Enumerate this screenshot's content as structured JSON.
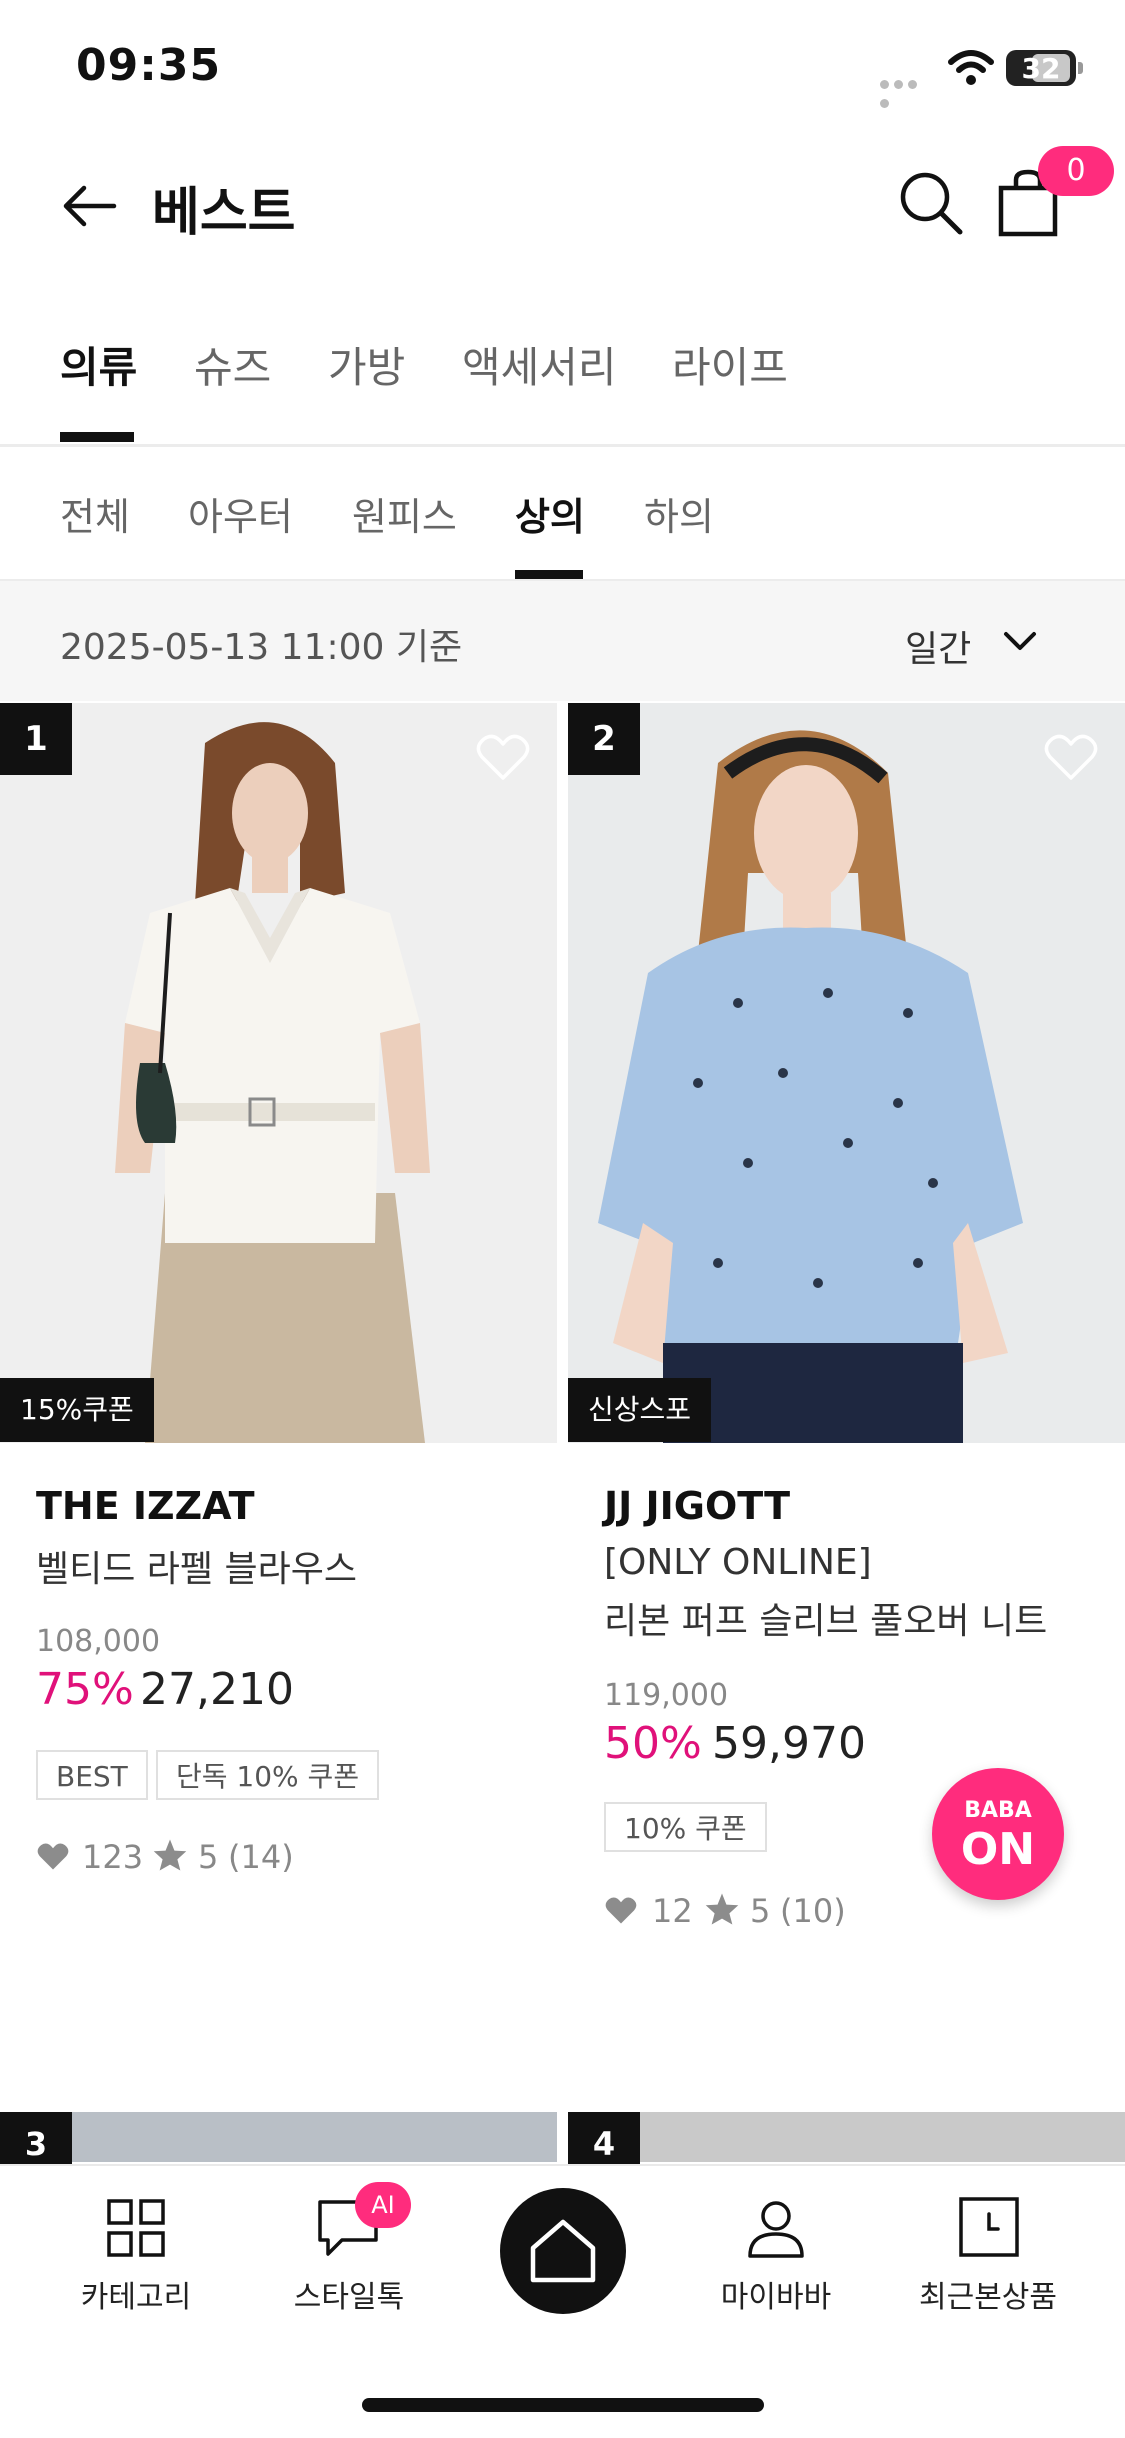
{
  "status_bar": {
    "time": "09:35",
    "battery": "32"
  },
  "header": {
    "title": "베스트",
    "cart_count": "0"
  },
  "main_tabs": [
    {
      "label": "의류",
      "active": true
    },
    {
      "label": "슈즈",
      "active": false
    },
    {
      "label": "가방",
      "active": false
    },
    {
      "label": "액세서리",
      "active": false
    },
    {
      "label": "라이프",
      "active": false
    }
  ],
  "sub_tabs": [
    {
      "label": "전체",
      "active": false
    },
    {
      "label": "아우터",
      "active": false
    },
    {
      "label": "원피스",
      "active": false
    },
    {
      "label": "상의",
      "active": true
    },
    {
      "label": "하의",
      "active": false
    }
  ],
  "filter": {
    "date_text": "2025-05-13 11:00 기준",
    "period": "일간"
  },
  "products": [
    {
      "rank": "1",
      "promo": "15%쿠폰",
      "brand": "THE IZZAT",
      "name_line1": "벨티드 라펠 블라우스",
      "name_line2": "",
      "original_price": "108,000",
      "discount": "75%",
      "price": "27,210",
      "chips": [
        "BEST",
        "단독 10% 쿠폰"
      ],
      "likes": "123",
      "rating": "5",
      "reviews": "(14)"
    },
    {
      "rank": "2",
      "promo": "신상스포",
      "brand": "JJ JIGOTT",
      "name_line1": "[ONLY ONLINE]",
      "name_line2": "리본 퍼프 슬리브 풀오버 니트",
      "original_price": "119,000",
      "discount": "50%",
      "price": "59,970",
      "chips": [
        "10% 쿠폰"
      ],
      "likes": "12",
      "rating": "5",
      "reviews": "(10)"
    }
  ],
  "next_ranks": [
    "3",
    "4"
  ],
  "floating": {
    "line1": "BABA",
    "line2": "ON"
  },
  "bottom_nav": {
    "category": "카테고리",
    "styletalk": "스타일톡",
    "ai_badge": "AI",
    "mybaba": "마이바바",
    "recent": "최근본상품"
  },
  "colors": {
    "accent": "#ff2c7d",
    "discount": "#e0117a"
  }
}
